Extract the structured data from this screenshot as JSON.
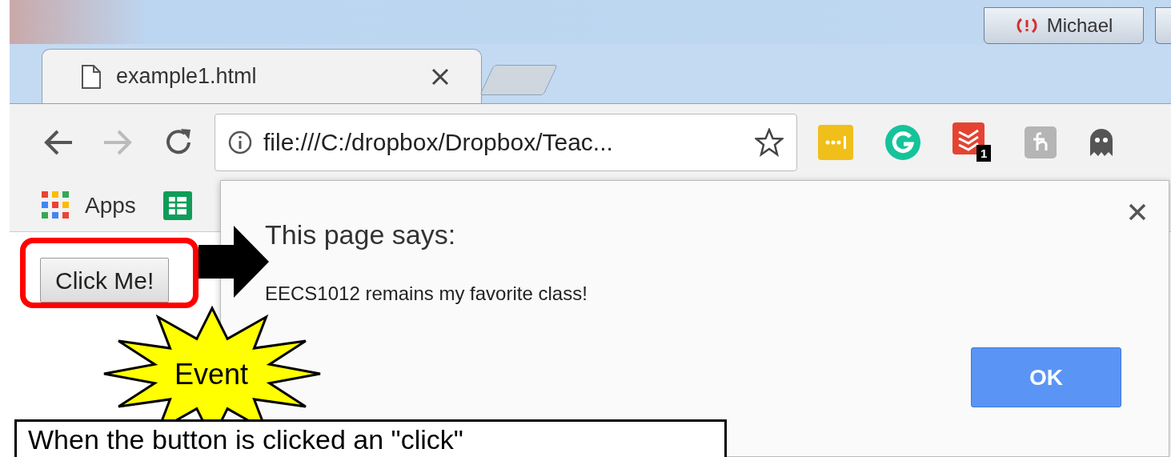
{
  "browser": {
    "profile": {
      "name": "Michael"
    },
    "tabs": [
      {
        "title": "example1.html",
        "selected": true
      }
    ],
    "address_bar": {
      "url": "file:///C:/dropbox/Dropbox/Teac..."
    },
    "extensions": [
      {
        "kind": "meter"
      },
      {
        "kind": "grammar"
      },
      {
        "kind": "todo",
        "badge": "1"
      },
      {
        "kind": "letter"
      },
      {
        "kind": "ghost"
      }
    ],
    "bookmarks": [
      {
        "kind": "apps",
        "label": "Apps"
      },
      {
        "kind": "sheets"
      }
    ]
  },
  "page": {
    "button": "Click Me!"
  },
  "dialog": {
    "title": "This page says:",
    "message": "EECS1012 remains my favorite class!",
    "ok": "OK"
  },
  "annotations": {
    "burst": "Event",
    "caption": "When the button is clicked an \"click\""
  }
}
